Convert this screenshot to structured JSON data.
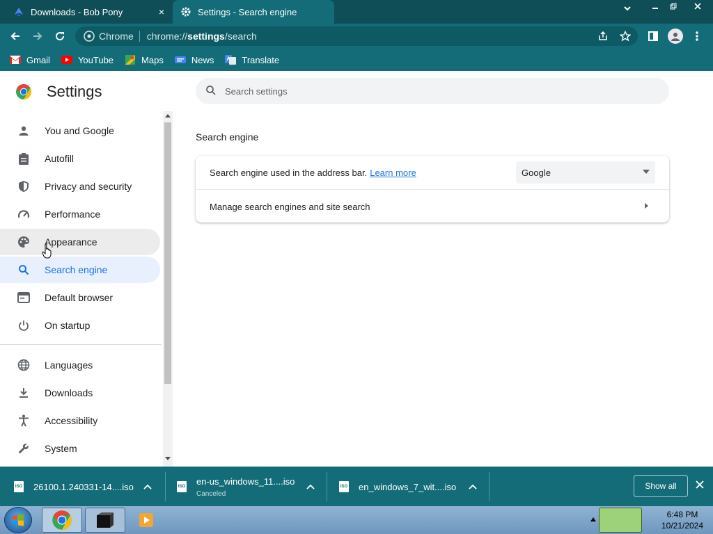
{
  "tabs": [
    {
      "label": "Downloads - Bob Pony",
      "close": "×"
    },
    {
      "label": "Settings - Search engine"
    }
  ],
  "toolbar": {
    "chip": "Chrome",
    "url_host": "chrome://",
    "url_bold": "settings",
    "url_path": "/search"
  },
  "bookmarks": [
    {
      "label": "Gmail"
    },
    {
      "label": "YouTube"
    },
    {
      "label": "Maps"
    },
    {
      "label": "News"
    },
    {
      "label": "Translate"
    }
  ],
  "settings": {
    "title": "Settings",
    "search_placeholder": "Search settings"
  },
  "sidebar": {
    "items": [
      {
        "label": "You and Google"
      },
      {
        "label": "Autofill"
      },
      {
        "label": "Privacy and security"
      },
      {
        "label": "Performance"
      },
      {
        "label": "Appearance"
      },
      {
        "label": "Search engine"
      },
      {
        "label": "Default browser"
      },
      {
        "label": "On startup"
      },
      {
        "label": "Languages"
      },
      {
        "label": "Downloads"
      },
      {
        "label": "Accessibility"
      },
      {
        "label": "System"
      }
    ]
  },
  "main": {
    "section_title": "Search engine",
    "row1_text": "Search engine used in the address bar.",
    "learn_more": "Learn more",
    "selected_engine": "Google",
    "row2_text": "Manage search engines and site search"
  },
  "downloads": [
    {
      "name": "26100.1.240331-14....iso",
      "status": ""
    },
    {
      "name": "en-us_windows_11....iso",
      "status": "Canceled"
    },
    {
      "name": "en_windows_7_wit....iso",
      "status": ""
    }
  ],
  "shelf": {
    "show_all": "Show all"
  },
  "taskbar": {
    "time": "6:48 PM",
    "date": "10/21/2024"
  },
  "colors": {
    "frame": "#0f4e57",
    "toolbar": "#136c78",
    "accent": "#1a73e8",
    "active_nav_bg": "#e8f0fe"
  }
}
